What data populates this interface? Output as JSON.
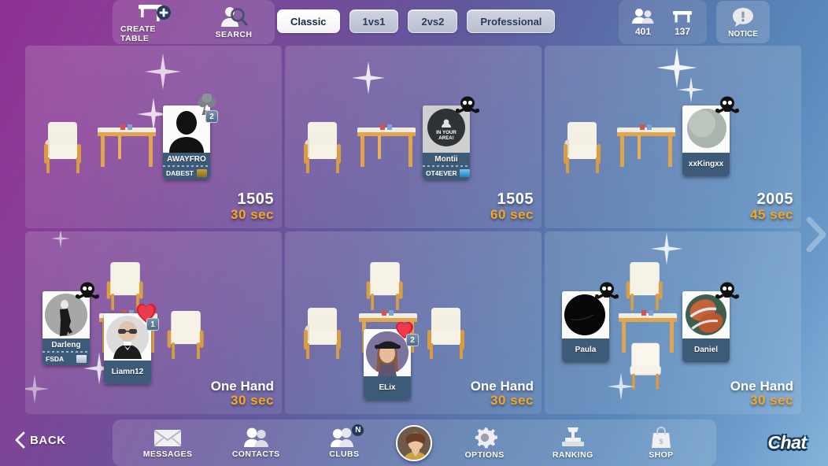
{
  "header": {
    "create_table_label": "CREATE TABLE",
    "create_table_icon": "table-plus-icon",
    "search_label": "SEARCH",
    "search_icon": "person-search-icon",
    "filters": [
      {
        "label": "Classic",
        "active": true
      },
      {
        "label": "1vs1",
        "active": false
      },
      {
        "label": "2vs2",
        "active": false
      },
      {
        "label": "Professional",
        "active": false
      }
    ],
    "counters": [
      {
        "icon": "players-icon",
        "value": "401"
      },
      {
        "icon": "tables-icon",
        "value": "137"
      }
    ],
    "notice_label": "NOTICE",
    "notice_icon": "notice-bubble-icon"
  },
  "tables": [
    {
      "score": "1505",
      "time": "30 sec",
      "mode": "",
      "players": [
        {
          "name": "AWAYFRO",
          "club": "DABEST",
          "badge": "club-ace-icon",
          "count": "2",
          "avatar": "silhouette-avatar",
          "has_club": true
        }
      ],
      "empty_seats": 1
    },
    {
      "score": "1505",
      "time": "60 sec",
      "mode": "",
      "players": [
        {
          "name": "Montii",
          "club": "OT4EVER",
          "badge": "skull-icon",
          "count": "",
          "avatar": "in-your-area-avatar",
          "avatar_text": "IN YOUR AREA!",
          "has_club": true
        }
      ],
      "empty_seats": 1
    },
    {
      "score": "2005",
      "time": "45 sec",
      "mode": "",
      "players": [
        {
          "name": "xxKingxx",
          "club": "",
          "badge": "skull-icon",
          "count": "",
          "avatar": "sphere-avatar",
          "has_club": false
        }
      ],
      "empty_seats": 1
    },
    {
      "score": "",
      "time": "30 sec",
      "mode": "One Hand",
      "players": [
        {
          "name": "Darleng",
          "club": "FSDA",
          "badge": "skull-icon",
          "count": "",
          "avatar": "dancer-avatar",
          "has_club": true
        },
        {
          "name": "Liamn12",
          "club": "",
          "badge": "heart-icon",
          "count": "1",
          "avatar": "man-glasses-avatar",
          "has_club": false
        }
      ],
      "empty_seats": 2
    },
    {
      "score": "",
      "time": "30 sec",
      "mode": "One Hand",
      "players": [
        {
          "name": "ELix",
          "club": "",
          "badge": "heart-icon",
          "count": "2",
          "avatar": "woman-cap-avatar",
          "has_club": false
        }
      ],
      "empty_seats": 3
    },
    {
      "score": "",
      "time": "30 sec",
      "mode": "One Hand",
      "players": [
        {
          "name": "Paula",
          "club": "",
          "badge": "skull-icon",
          "count": "",
          "avatar": "black-circle-avatar",
          "has_club": false
        },
        {
          "name": "Daniel",
          "club": "",
          "badge": "skull-icon",
          "count": "",
          "avatar": "basketball-avatar",
          "has_club": false
        }
      ],
      "empty_seats": 2
    }
  ],
  "bottom_nav": {
    "back_label": "BACK",
    "back_icon": "chevron-left-icon",
    "items": [
      {
        "label": "MESSAGES",
        "icon": "envelope-icon",
        "badge": ""
      },
      {
        "label": "CONTACTS",
        "icon": "contacts-icon",
        "badge": ""
      },
      {
        "label": "CLUBS",
        "icon": "clubs-icon",
        "badge": "N"
      },
      {
        "label": "OPTIONS",
        "icon": "gear-icon",
        "badge": ""
      },
      {
        "label": "RANKING",
        "icon": "podium-trophy-icon",
        "badge": ""
      },
      {
        "label": "SHOP",
        "icon": "shopping-bag-icon",
        "badge": ""
      }
    ],
    "profile_avatar": "user-profile-avatar",
    "chat_label": "Chat",
    "chat_icon": "chat-button"
  },
  "colors": {
    "accent_time": "#f5a623",
    "card_name_bar": "#3d5a78",
    "bg_left": "#8e2f92",
    "bg_right": "#84b3da"
  }
}
